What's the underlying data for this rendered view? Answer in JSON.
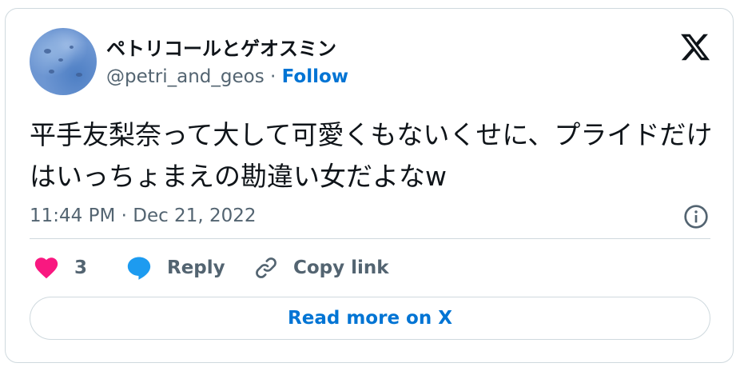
{
  "author": {
    "display_name": "ペトリコールとゲオスミン",
    "handle": "@petri_and_geos",
    "separator": " · ",
    "follow_label": "Follow"
  },
  "tweet": {
    "text": "平手友梨奈って大して可愛くもないくせに、プライドだけはいっちょまえの勘違い女だよなw",
    "timestamp": "11:44 PM · Dec 21, 2022"
  },
  "actions": {
    "like_count": "3",
    "reply_label": "Reply",
    "copy_label": "Copy link"
  },
  "read_more_label": "Read more on X",
  "colors": {
    "accent": "#0074d4",
    "heart": "#f91880",
    "reply_bubble": "#1d9bf0",
    "text_primary": "#0f1419",
    "text_secondary": "#536471",
    "border": "#cfd9de"
  },
  "icons": {
    "brand": "x-logo-icon",
    "info": "info-icon",
    "like": "heart-icon",
    "reply": "speech-bubble-icon",
    "copy": "link-icon"
  }
}
